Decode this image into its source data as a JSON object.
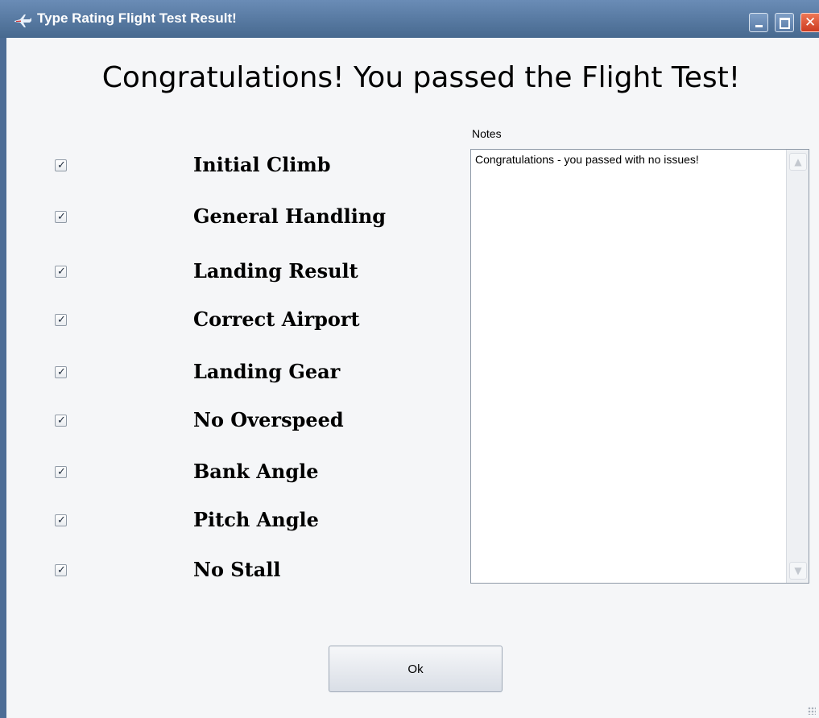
{
  "window": {
    "title": "Type Rating Flight Test Result!",
    "title_icon": "airplane-icon",
    "controls": [
      "minimize",
      "maximize",
      "close"
    ]
  },
  "headline": "Congratulations!  You passed the Flight Test!",
  "checks": [
    {
      "label": "Initial Climb",
      "checked": true
    },
    {
      "label": "General Handling",
      "checked": true
    },
    {
      "label": "Landing Result",
      "checked": true
    },
    {
      "label": "Correct Airport",
      "checked": true
    },
    {
      "label": "Landing Gear",
      "checked": true
    },
    {
      "label": "No Overspeed",
      "checked": true
    },
    {
      "label": "Bank Angle",
      "checked": true
    },
    {
      "label": "Pitch Angle",
      "checked": true
    },
    {
      "label": "No Stall",
      "checked": true
    }
  ],
  "notes": {
    "label": "Notes",
    "text": "Congratulations - you passed with no issues!"
  },
  "ok_button": {
    "label": "Ok"
  },
  "colors": {
    "titlebar": "#47698f",
    "close_button": "#cc3b21",
    "background": "#f5f6f8"
  }
}
